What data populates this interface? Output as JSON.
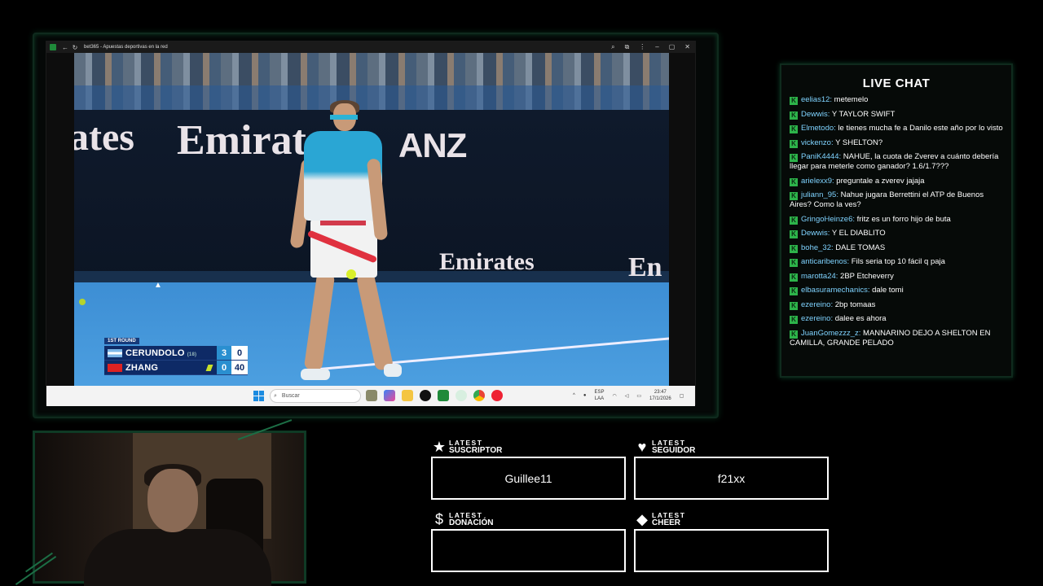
{
  "browser": {
    "title": "bet365 - Apuestas deportivas en la red"
  },
  "scoreboard": {
    "round": "1ST ROUND",
    "players": [
      {
        "name": "CERUNDOLO",
        "seed": "(18)",
        "sets": "3",
        "points": "0"
      },
      {
        "name": "ZHANG",
        "seed": "",
        "sets": "0",
        "points": "40"
      }
    ]
  },
  "court_ads": {
    "ad1": "Emirates",
    "ad2": "ates",
    "ad3": "ANZ",
    "ad4": "Emirates",
    "ad5": "En"
  },
  "taskbar": {
    "search_placeholder": "Buscar",
    "lang": "ESP",
    "lang2": "LAA",
    "time": "23:47",
    "date": "17/1/2026"
  },
  "chat": {
    "title": "LIVE CHAT",
    "messages": [
      {
        "user": "eelias12:",
        "text": " metemelo"
      },
      {
        "user": "Dewwis:",
        "text": " Y TAYLOR SWIFT"
      },
      {
        "user": "Elmetodo:",
        "text": " le tienes mucha fe a Danilo este año por lo visto"
      },
      {
        "user": "vickenzo:",
        "text": " Y SHELTON?"
      },
      {
        "user": "PaniK4444:",
        "text": " NAHUE, la cuota de Zverev a cuánto debería llegar para meterle como ganador? 1.6/1.7???"
      },
      {
        "user": "arielexx9:",
        "text": " preguntale a zverev jajaja"
      },
      {
        "user": "juliann_95:",
        "text": " Nahue jugara Berrettini el ATP de Buenos Aires? Como la ves?"
      },
      {
        "user": "GringoHeinze6:",
        "text": " fritz es un forro hijo de buta"
      },
      {
        "user": "Dewwis:",
        "text": " Y EL DIABLITO"
      },
      {
        "user": "bohe_32:",
        "text": " DALE TOMAS"
      },
      {
        "user": "anticaribenos:",
        "text": " Fils seria top 10 fácil q paja"
      },
      {
        "user": "marotta24:",
        "text": " 2BP Etcheverry"
      },
      {
        "user": "elbasuramechanics:",
        "text": " dale tomi"
      },
      {
        "user": "ezereino:",
        "text": " 2bp tomaas"
      },
      {
        "user": "ezereino:",
        "text": " dalee es ahora"
      },
      {
        "user": "JuanGomezzz_z:",
        "text": " MANNARINO DEJO A SHELTON EN CAMILLA, GRANDE PELADO"
      }
    ]
  },
  "alerts": {
    "subscriber": {
      "label1": "LATEST",
      "label2": "SUSCRIPTOR",
      "value": "Guillee11",
      "icon": "star-icon"
    },
    "follower": {
      "label1": "LATEST",
      "label2": "SEGUIDOR",
      "value": "f21xx",
      "icon": "heart-icon"
    },
    "donation": {
      "label1": "LATEST",
      "label2": "DONACIÓN",
      "value": "",
      "icon": "dollar-icon"
    },
    "cheer": {
      "label1": "LATEST",
      "label2": "CHEER",
      "value": "",
      "icon": "diamond-icon"
    }
  },
  "colors": {
    "accent": "#1c6e45",
    "chat_user": "#7fd3ff",
    "badge": "#2db34a"
  }
}
